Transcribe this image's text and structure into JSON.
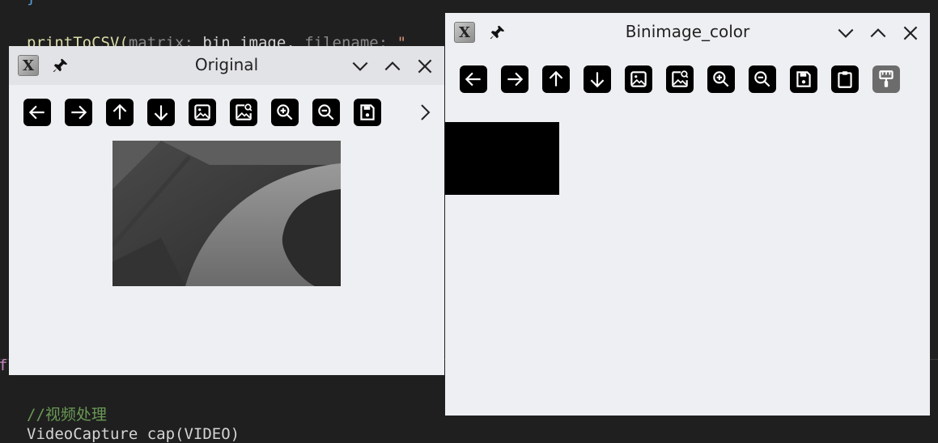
{
  "editor": {
    "line_top": "}",
    "call_fn": "printToCSV(",
    "hint_matrix": "matrix:",
    "arg_bin": " bin_image, ",
    "hint_filename": "filename:",
    "str_quote": " \"",
    "left_f": "f",
    "comment": "//视频处理",
    "bottom_text": "VideoCapture cap(VIDEO)"
  },
  "windows": {
    "original": {
      "title": "Original"
    },
    "binimage": {
      "title": "Binimage_color"
    }
  },
  "icons": {
    "back": "arrow-left-icon",
    "forward": "arrow-right-icon",
    "up": "arrow-up-icon",
    "down": "arrow-down-icon",
    "image": "image-icon",
    "image_search": "image-search-icon",
    "zoom_in": "zoom-in-icon",
    "zoom_out": "zoom-out-icon",
    "save": "save-icon",
    "clipboard": "clipboard-icon",
    "paint": "paint-roller-icon"
  },
  "colors": {
    "window_bg": "#eeeff2",
    "button_bg": "#000000",
    "editor_bg": "#1f1f1f"
  }
}
